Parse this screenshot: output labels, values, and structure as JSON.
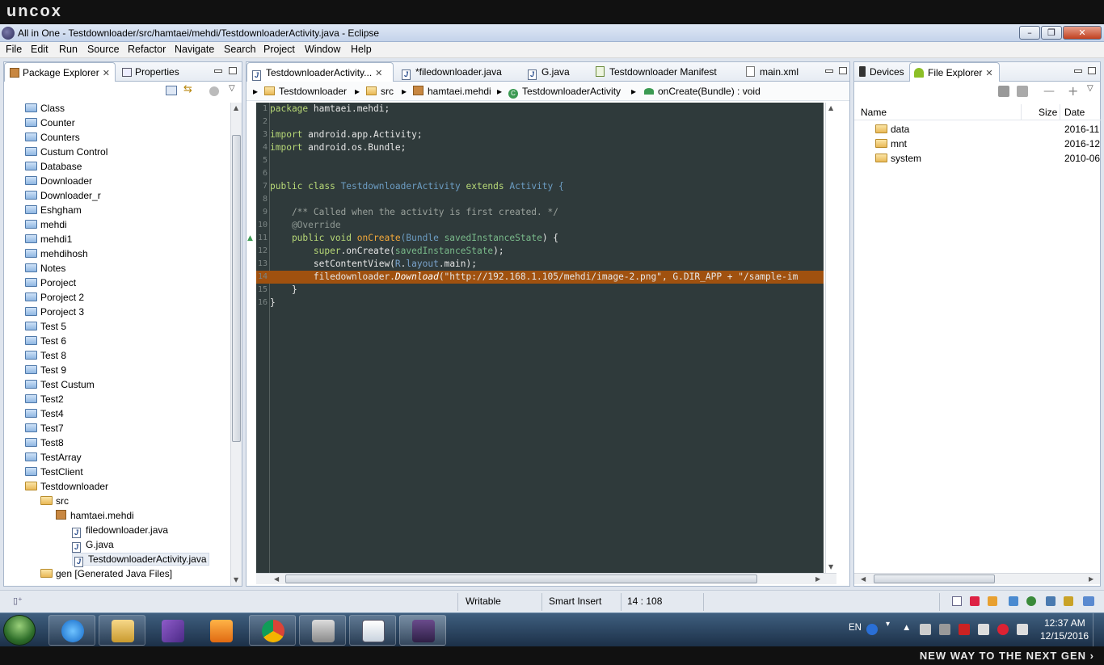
{
  "brand": {
    "logo": "uncox",
    "tagline": "NEW WAY TO THE NEXT GEN ›"
  },
  "window": {
    "title": "All in One - Testdownloader/src/hamtaei/mehdi/TestdownloaderActivity.java - Eclipse"
  },
  "menu": [
    "File",
    "Edit",
    "Run",
    "Source",
    "Refactor",
    "Navigate",
    "Search",
    "Project",
    "Window",
    "Help"
  ],
  "left_panel": {
    "tabs": [
      "Package Explorer",
      "Properties"
    ],
    "tree": [
      "Class",
      "Counter",
      "Counters",
      "Custum Control",
      "Database",
      "Downloader",
      "Downloader_r",
      "Eshgham",
      "mehdi",
      "mehdi1",
      "mehdihosh",
      "Notes",
      "Poroject",
      "Poroject 2",
      "Poroject 3",
      "Test 5",
      "Test 6",
      "Test 8",
      "Test 9",
      "Test Custum",
      "Test2",
      "Test4",
      "Test7",
      "Test8",
      "TestArray",
      "TestClient",
      "Testdownloader"
    ],
    "src": "src",
    "package": "hamtaei.mehdi",
    "files": [
      "filedownloader.java",
      "G.java",
      "TestdownloaderActivity.java"
    ],
    "gen": "gen [Generated Java Files]"
  },
  "editor": {
    "tabs": [
      "TestdownloaderActivity...",
      "*filedownloader.java",
      "G.java",
      "Testdownloader Manifest",
      "main.xml"
    ],
    "breadcrumb": [
      "Testdownloader",
      "src",
      "hamtaei.mehdi",
      "TestdownloaderActivity",
      "onCreate(Bundle) : void"
    ],
    "line_numbers": [
      "1",
      "2",
      "3",
      "4",
      "5",
      "6",
      "7",
      "8",
      "9",
      "10",
      "11",
      "12",
      "13",
      "14",
      "15",
      "16"
    ],
    "code": {
      "l1_kw": "package",
      "l1_rest": " hamtaei.mehdi;",
      "l3_kw": "import",
      "l3_rest": " android.app.Activity;",
      "l4_kw": "import",
      "l4_rest": " android.os.Bundle;",
      "l7_a": "public class",
      "l7_b": " TestdownloaderActivity ",
      "l7_c": "extends",
      "l7_d": " Activity {",
      "l9": "    /** Called when the activity is first created. */",
      "l10": "    @Override",
      "l11_a": "    public void ",
      "l11_b": "onCreate",
      "l11_c": "(Bundle ",
      "l11_d": "savedInstanceState",
      "l11_e": ") {",
      "l12_a": "        super",
      "l12_b": ".onCreate(",
      "l12_c": "savedInstanceState",
      "l12_d": ");",
      "l13_a": "        setContentView(",
      "l13_b": "R",
      "l13_c": ".",
      "l13_d": "layout",
      "l13_e": ".main);",
      "l14_a": "        filedownloader.",
      "l14_b": "Download",
      "l14_c": "(\"http://192.168.1.105/mehdi/image-2.png\", G.DIR_APP + \"/sample-im",
      "l15": "    }",
      "l16": "}"
    }
  },
  "right_panel": {
    "tabs": [
      "Devices",
      "File Explorer"
    ],
    "columns": [
      "Name",
      "Size",
      "Date"
    ],
    "rows": [
      {
        "name": "data",
        "date": "2016-11"
      },
      {
        "name": "mnt",
        "date": "2016-12"
      },
      {
        "name": "system",
        "date": "2010-06"
      }
    ]
  },
  "status": {
    "mode": "Writable",
    "insert": "Smart Insert",
    "position": "14 : 108"
  },
  "taskbar": {
    "lang": "EN",
    "time": "12:37 AM",
    "date": "12/15/2016"
  },
  "colors": {
    "editor_bg": "#2f3a3b",
    "highlight": "#a0510f",
    "keyword": "#b8d977",
    "type": "#6c9dc3"
  }
}
